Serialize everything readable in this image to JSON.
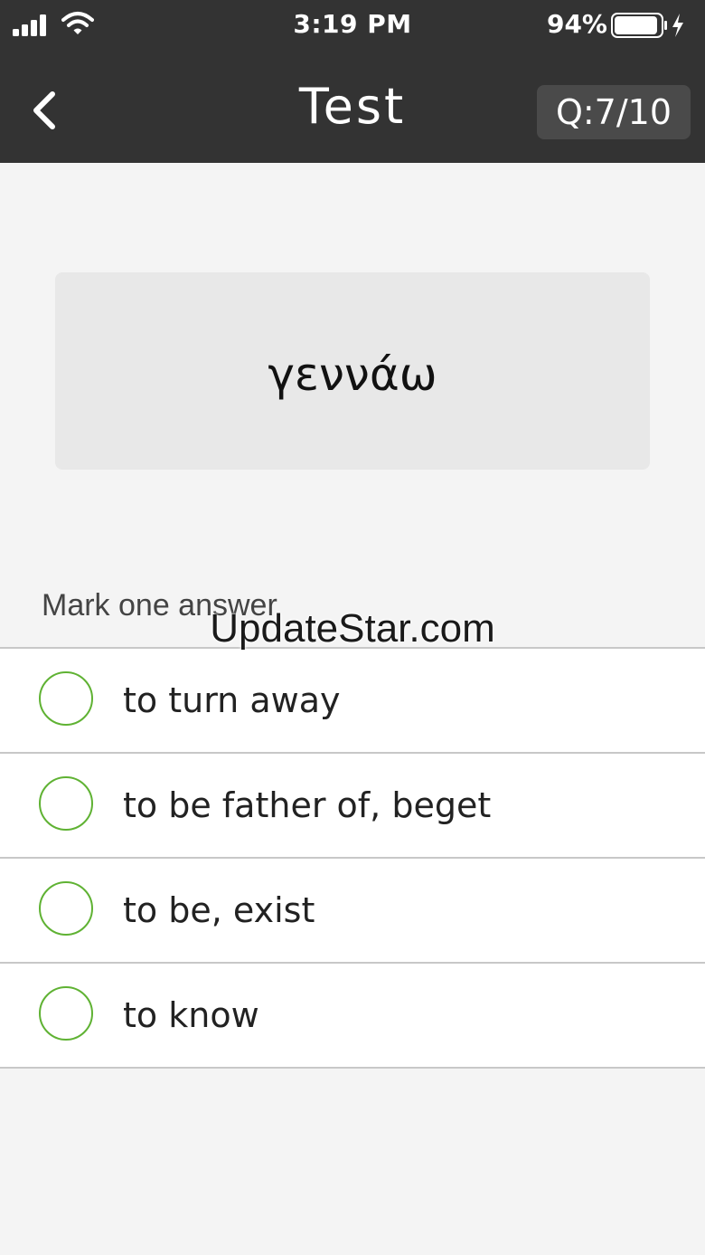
{
  "status_bar": {
    "time": "3:19 PM",
    "battery_percent": "94%",
    "battery_level": 0.94,
    "icons": [
      "signal-icon",
      "wifi-icon",
      "battery-icon",
      "charging-icon"
    ]
  },
  "nav": {
    "title": "Test",
    "question_counter": "Q:7/10",
    "back_icon": "chevron-left-icon"
  },
  "card": {
    "word": "γεννάω"
  },
  "prompt": "Mark one answer",
  "watermark": "UpdateStar.com",
  "options": [
    {
      "label": "to turn away",
      "selected": false
    },
    {
      "label": "to be father of, beget",
      "selected": false
    },
    {
      "label": "to be, exist",
      "selected": false
    },
    {
      "label": "to know",
      "selected": false
    }
  ],
  "colors": {
    "nav_background": "#333333",
    "page_background": "#f4f4f4",
    "card_background": "#e8e8e8",
    "radio_accent": "#5fb233"
  }
}
